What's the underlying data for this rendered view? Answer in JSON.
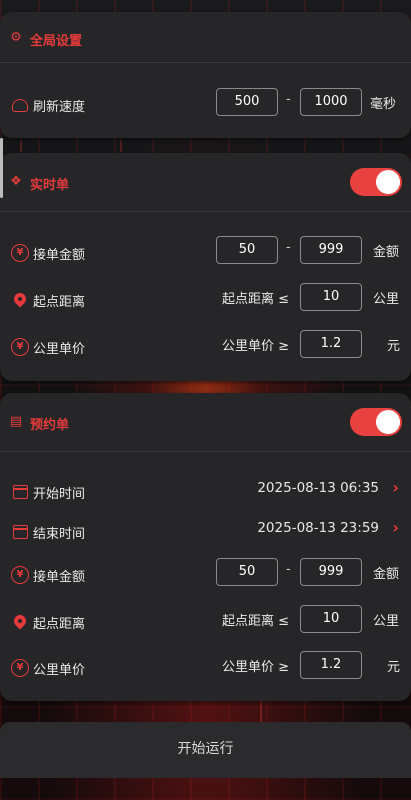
{
  "colors": {
    "accent": "#e53b3b",
    "toggle_on": "#e94040",
    "card": "#262628"
  },
  "global": {
    "title": "全局设置",
    "refresh": {
      "label": "刷新速度",
      "min": "500",
      "sep": "-",
      "max": "1000",
      "unit": "毫秒"
    }
  },
  "realtime": {
    "title": "实时单",
    "enabled": true,
    "amount": {
      "label": "接单金额",
      "min": "50",
      "sep": "-",
      "max": "999",
      "unit": "金额"
    },
    "distance": {
      "label": "起点距离",
      "prefix": "起点距离 ≤",
      "value": "10",
      "unit": "公里"
    },
    "price": {
      "label": "公里单价",
      "prefix": "公里单价 ≥",
      "value": "1.2",
      "unit": "元"
    }
  },
  "booking": {
    "title": "预约单",
    "enabled": true,
    "start_time": {
      "label": "开始时间",
      "value": "2025-08-13 06:35"
    },
    "end_time": {
      "label": "结束时间",
      "value": "2025-08-13 23:59"
    },
    "amount": {
      "label": "接单金额",
      "min": "50",
      "sep": "-",
      "max": "999",
      "unit": "金额"
    },
    "distance": {
      "label": "起点距离",
      "prefix": "起点距离 ≤",
      "value": "10",
      "unit": "公里"
    },
    "price": {
      "label": "公里单价",
      "prefix": "公里单价 ≥",
      "value": "1.2",
      "unit": "元"
    }
  },
  "action": {
    "start_label": "开始运行"
  },
  "icons": [
    "gear-icon",
    "speedometer-icon",
    "diamond-icon",
    "yuan-icon",
    "location-pin-icon",
    "calendar-icon",
    "calendar-end-icon",
    "chevron-right-icon",
    "ticket-icon"
  ]
}
